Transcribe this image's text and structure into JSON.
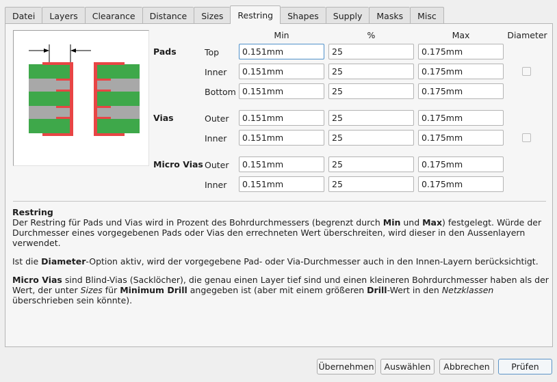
{
  "tabs": [
    "Datei",
    "Layers",
    "Clearance",
    "Distance",
    "Sizes",
    "Restring",
    "Shapes",
    "Supply",
    "Masks",
    "Misc"
  ],
  "active_tab": "Restring",
  "columns": {
    "min": "Min",
    "pct": "%",
    "max": "Max",
    "diameter": "Diameter"
  },
  "groups": {
    "pads": {
      "label": "Pads",
      "rows": [
        {
          "label": "Top",
          "min": "0.151mm",
          "pct": "25",
          "max": "0.175mm"
        },
        {
          "label": "Inner",
          "min": "0.151mm",
          "pct": "25",
          "max": "0.175mm"
        },
        {
          "label": "Bottom",
          "min": "0.151mm",
          "pct": "25",
          "max": "0.175mm"
        }
      ],
      "diameter_checked": false
    },
    "vias": {
      "label": "Vias",
      "rows": [
        {
          "label": "Outer",
          "min": "0.151mm",
          "pct": "25",
          "max": "0.175mm"
        },
        {
          "label": "Inner",
          "min": "0.151mm",
          "pct": "25",
          "max": "0.175mm"
        }
      ],
      "diameter_checked": false
    },
    "micro_vias": {
      "label": "Micro Vias",
      "rows": [
        {
          "label": "Outer",
          "min": "0.151mm",
          "pct": "25",
          "max": "0.175mm"
        },
        {
          "label": "Inner",
          "min": "0.151mm",
          "pct": "25",
          "max": "0.175mm"
        }
      ]
    }
  },
  "help": {
    "title": "Restring",
    "p1_a": "Der Restring für Pads und Vias wird in Prozent des Bohrdurchmessers (begrenzt durch ",
    "p1_b": "Min",
    "p1_c": " und ",
    "p1_d": "Max",
    "p1_e": ") festgelegt. Würde der Durchmesser eines vorgegebenen Pads oder Vias den errechneten Wert überschreiten, wird dieser in den Aussenlayern verwendet.",
    "p2_a": "Ist die ",
    "p2_b": "Diameter",
    "p2_c": "-Option aktiv, wird der vorgegebene Pad- oder Via-Durchmesser auch in den Innen-Layern berücksichtigt.",
    "p3_a": "Micro Vias",
    "p3_b": " sind Blind-Vias (Sacklöcher), die genau einen Layer tief sind und einen kleineren Bohrdurchmesser haben als der Wert, der unter ",
    "p3_c": "Sizes",
    "p3_d": " für ",
    "p3_e": "Minimum Drill",
    "p3_f": " angegeben ist (aber mit einem größeren ",
    "p3_g": "Drill",
    "p3_h": "-Wert in den ",
    "p3_i": "Netzklassen",
    "p3_j": " überschrieben sein könnte)."
  },
  "buttons": {
    "apply": "Übernehmen",
    "select": "Auswählen",
    "cancel": "Abbrechen",
    "check": "Prüfen"
  },
  "colors": {
    "copper": "#e84545",
    "layer": "#3ea84a",
    "core": "#a8a8a8",
    "focus": "#4f90c9"
  }
}
